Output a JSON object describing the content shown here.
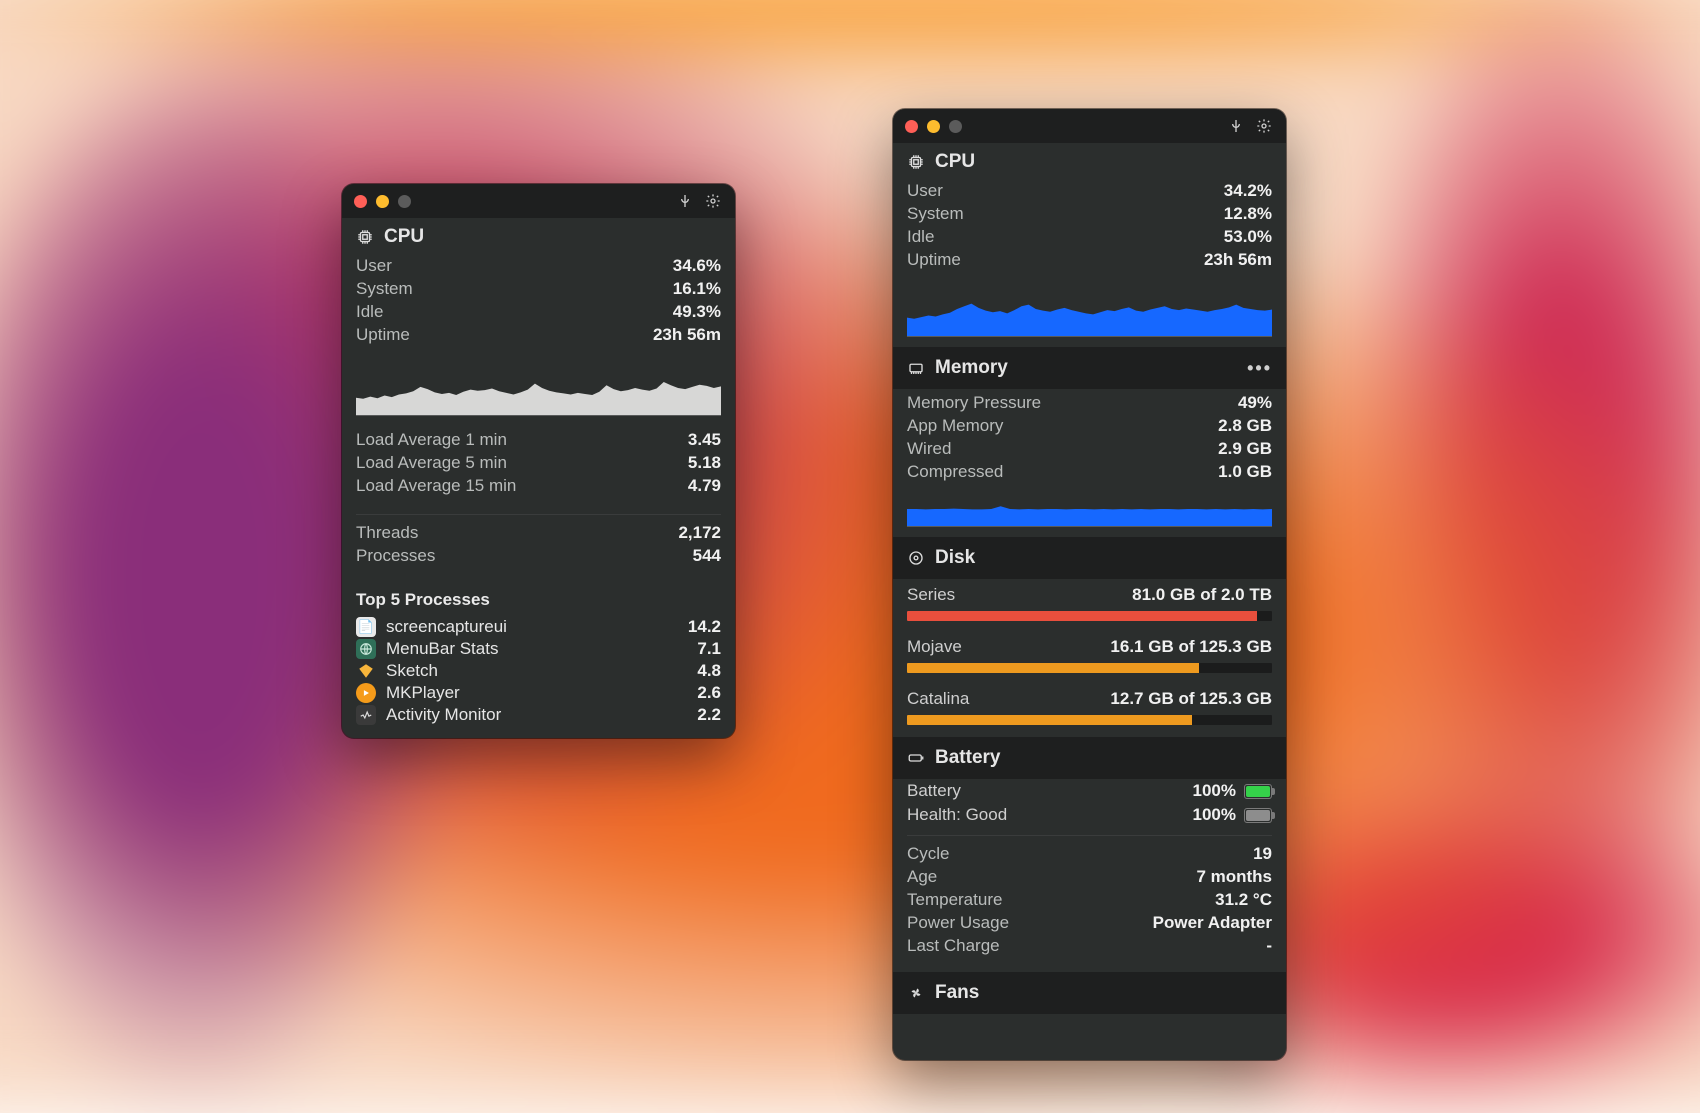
{
  "colors": {
    "graph_fill_light": "#d7d7d6",
    "graph_fill_blue": "#1668ff",
    "disk_red": "#e94f3d",
    "disk_orange": "#ee9a1f"
  },
  "left": {
    "cpu_title": "CPU",
    "rows": [
      {
        "label": "User",
        "value": "34.6%"
      },
      {
        "label": "System",
        "value": "16.1%"
      },
      {
        "label": "Idle",
        "value": "49.3%"
      },
      {
        "label": "Uptime",
        "value": "23h 56m"
      }
    ],
    "load": [
      {
        "label": "Load Average 1 min",
        "value": "3.45"
      },
      {
        "label": "Load Average 5 min",
        "value": "5.18"
      },
      {
        "label": "Load Average 15 min",
        "value": "4.79"
      }
    ],
    "threads_label": "Threads",
    "threads_value": "2,172",
    "processes_label": "Processes",
    "processes_value": "544",
    "top_title": "Top 5 Processes",
    "procs": [
      {
        "icon": "doc",
        "name": "screencaptureui",
        "value": "14.2"
      },
      {
        "icon": "globe",
        "name": "MenuBar Stats",
        "value": "7.1"
      },
      {
        "icon": "sketch",
        "name": "Sketch",
        "value": "4.8"
      },
      {
        "icon": "play",
        "name": "MKPlayer",
        "value": "2.6"
      },
      {
        "icon": "am",
        "name": "Activity Monitor",
        "value": "2.2"
      }
    ]
  },
  "right": {
    "cpu_title": "CPU",
    "cpu_rows": [
      {
        "label": "User",
        "value": "34.2%"
      },
      {
        "label": "System",
        "value": "12.8%"
      },
      {
        "label": "Idle",
        "value": "53.0%"
      },
      {
        "label": "Uptime",
        "value": "23h 56m"
      }
    ],
    "mem_title": "Memory",
    "mem_rows": [
      {
        "label": "Memory Pressure",
        "value": "49%"
      },
      {
        "label": "App Memory",
        "value": "2.8 GB"
      },
      {
        "label": "Wired",
        "value": "2.9 GB"
      },
      {
        "label": "Compressed",
        "value": "1.0 GB"
      }
    ],
    "disk_title": "Disk",
    "disks": [
      {
        "name": "Series",
        "text": "81.0 GB of 2.0 TB",
        "pct": 96,
        "color": "#e94f3d"
      },
      {
        "name": "Mojave",
        "text": "16.1 GB of 125.3 GB",
        "pct": 80,
        "color": "#ee9a1f"
      },
      {
        "name": "Catalina",
        "text": "12.7 GB of 125.3 GB",
        "pct": 78,
        "color": "#ee9a1f"
      }
    ],
    "batt_title": "Battery",
    "batt_line": {
      "label": "Battery",
      "value": "100%"
    },
    "health_line": {
      "label": "Health: Good",
      "value": "100%"
    },
    "batt_rows": [
      {
        "label": "Cycle",
        "value": "19"
      },
      {
        "label": "Age",
        "value": "7 months"
      },
      {
        "label": "Temperature",
        "value": "31.2 °C"
      },
      {
        "label": "Power Usage",
        "value": "Power Adapter"
      },
      {
        "label": "Last Charge",
        "value": "-"
      }
    ],
    "fans_title": "Fans"
  },
  "chart_data": [
    {
      "type": "area",
      "title": "CPU history (left panel)",
      "ylim": [
        0,
        100
      ],
      "series": [
        {
          "name": "cpu_total_pct",
          "values": [
            32,
            30,
            34,
            31,
            36,
            33,
            38,
            40,
            44,
            52,
            48,
            42,
            39,
            41,
            37,
            43,
            47,
            45,
            46,
            49,
            44,
            41,
            38,
            42,
            47,
            58,
            50,
            45,
            42,
            40,
            38,
            41,
            39,
            37,
            43,
            55,
            48,
            44,
            46,
            50,
            47,
            45,
            49,
            61,
            55,
            50,
            48,
            52,
            56,
            54,
            50,
            53
          ]
        }
      ]
    },
    {
      "type": "area",
      "title": "CPU history (right panel)",
      "ylim": [
        0,
        100
      ],
      "series": [
        {
          "name": "cpu_total_pct",
          "values": [
            34,
            32,
            35,
            38,
            36,
            40,
            43,
            50,
            55,
            60,
            52,
            47,
            44,
            46,
            42,
            48,
            55,
            58,
            50,
            47,
            45,
            49,
            52,
            48,
            45,
            42,
            40,
            44,
            48,
            46,
            50,
            53,
            47,
            45,
            49,
            52,
            55,
            50,
            48,
            51,
            49,
            47,
            45,
            48,
            50,
            53,
            58,
            52,
            50,
            48,
            47,
            49
          ]
        }
      ]
    },
    {
      "type": "area",
      "title": "Memory pressure history",
      "ylim": [
        0,
        100
      ],
      "series": [
        {
          "name": "memory_pressure_pct",
          "values": [
            50,
            50,
            49,
            50,
            50,
            51,
            50,
            49,
            49,
            50,
            58,
            50,
            49,
            50,
            49,
            50,
            50,
            49,
            50,
            50,
            49,
            50,
            49,
            50,
            49,
            50,
            49,
            50,
            50,
            49,
            50,
            50,
            49,
            50,
            49,
            50,
            49,
            50,
            49,
            50
          ]
        }
      ]
    }
  ]
}
